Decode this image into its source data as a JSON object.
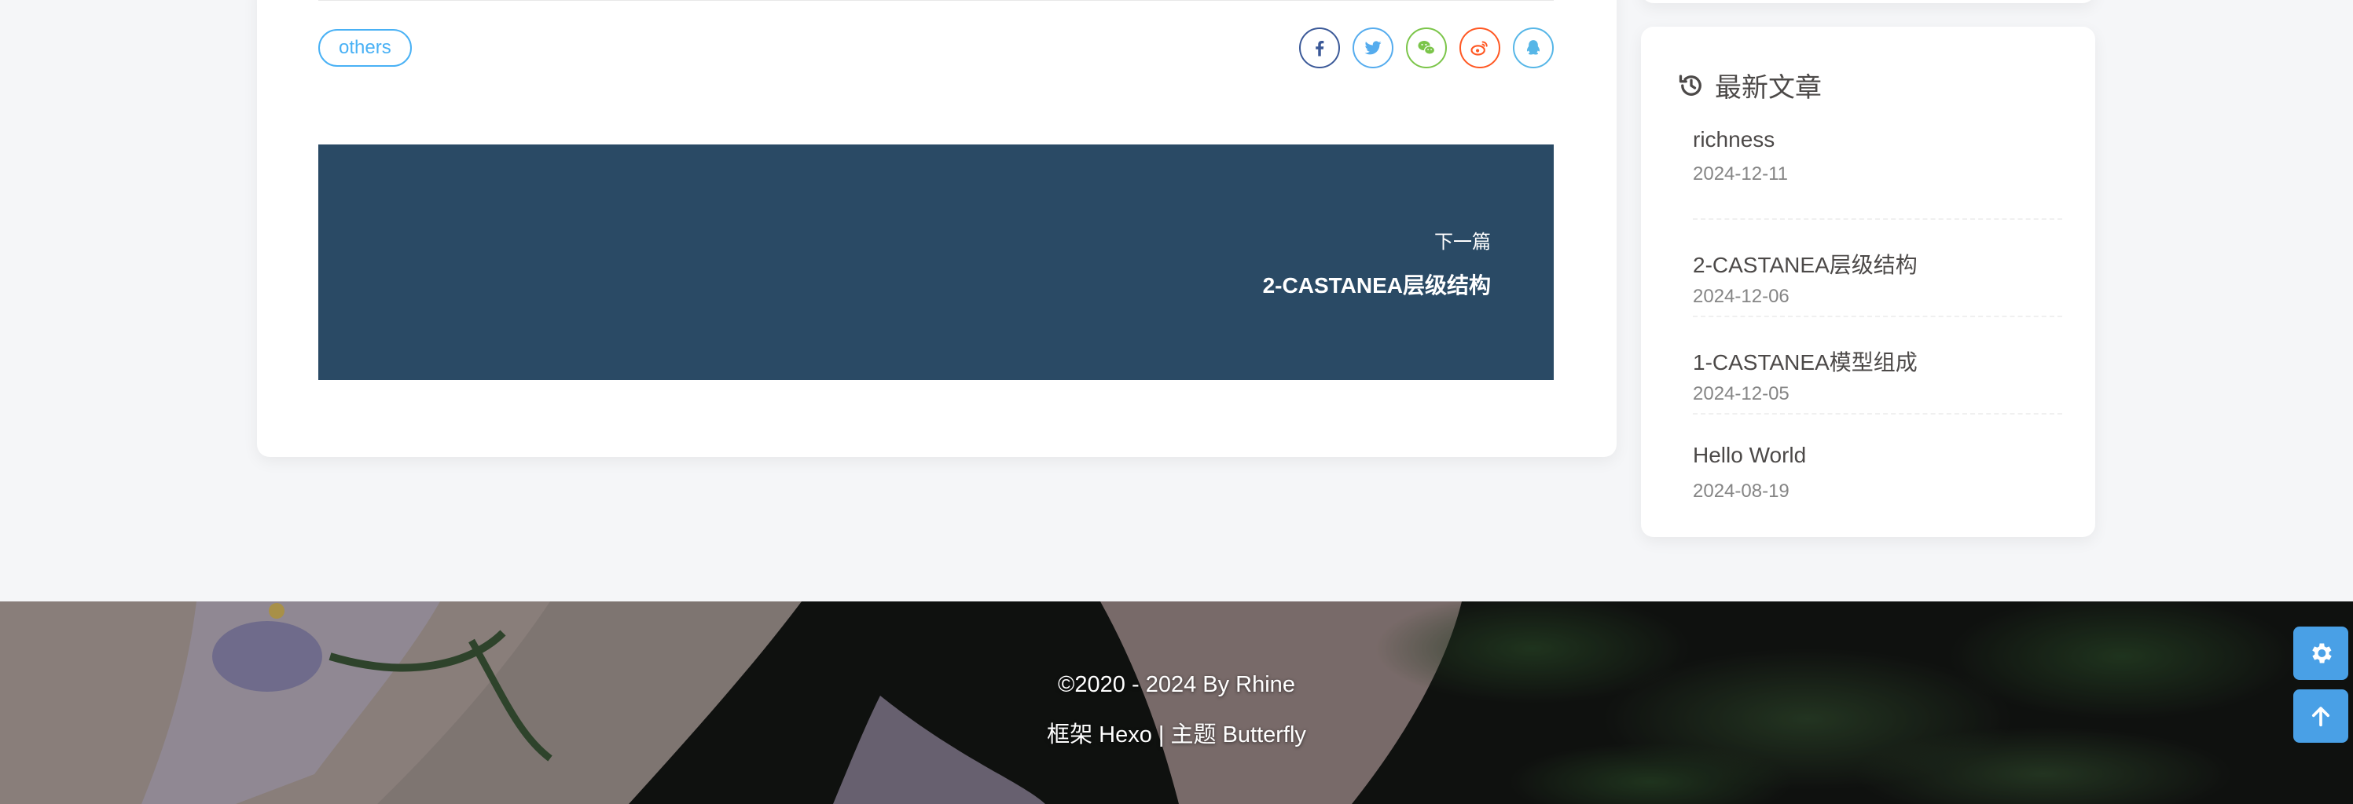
{
  "post": {
    "tag_label": "others",
    "share_icons": [
      {
        "name": "facebook",
        "color": "#3b5998"
      },
      {
        "name": "twitter",
        "color": "#55acee"
      },
      {
        "name": "wechat",
        "color": "#7bc549"
      },
      {
        "name": "weibo",
        "color": "#ff5722"
      },
      {
        "name": "qq",
        "color": "#56b6e7"
      }
    ],
    "next_post": {
      "label": "下一篇",
      "title": "2-CASTANEA层级结构"
    }
  },
  "sidebar": {
    "recent": {
      "title": "最新文章",
      "items": [
        {
          "title": "richness",
          "date": "2024-12-11"
        },
        {
          "title": "2-CASTANEA层级结构",
          "date": "2024-12-06"
        },
        {
          "title": "1-CASTANEA模型组成",
          "date": "2024-12-05"
        },
        {
          "title": "Hello World",
          "date": "2024-08-19"
        }
      ]
    }
  },
  "footer": {
    "copyright": "©2020 - 2024 By Rhine",
    "framework_line": "框架 Hexo | 主题 Butterfly"
  },
  "colors": {
    "accent": "#49b1f5",
    "next_post_bg": "#2a4a65",
    "float_button": "#49a0e6"
  }
}
